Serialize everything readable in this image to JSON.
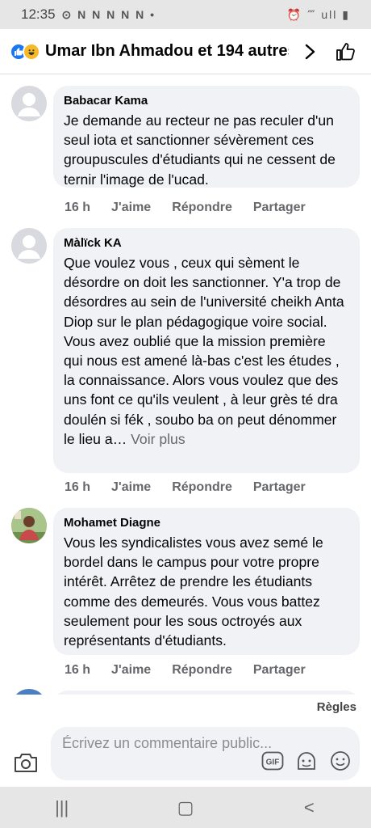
{
  "status": {
    "time": "12:35",
    "notifications": "⊙ N N N N N •",
    "right": "⏰ ⁗ ull ▮"
  },
  "header": {
    "title": "Umar Ibn Ahmadou et 194 autres ..."
  },
  "comments": [
    {
      "author": "Babacar Kama",
      "text": "Je demande au recteur ne pas reculer d'un seul iota et sanctionner sévèrement ces groupuscules d'étudiants qui ne cessent de ternir l'image de l'ucad.",
      "time": "16 h",
      "like": "J'aime",
      "reply": "Répondre",
      "share": "Partager"
    },
    {
      "author": "Màlïck KA",
      "text": "Que voulez vous , ceux qui sèment le désordre on doit les sanctionner. Y'a trop de désordres au sein de l'université cheikh Anta Diop sur le plan pédagogique voire social. Vous avez oublié que la mission première qui nous est amené là-bas c'est les études , la connaissance. Alors vous voulez que des uns font ce qu'ils veulent , à leur grès té dra doulén si fék , soubo ba on peut dénommer le lieu a…",
      "more": "Voir plus",
      "time": "16 h",
      "like": "J'aime",
      "reply": "Répondre",
      "share": "Partager"
    },
    {
      "author": "Mohamet Diagne",
      "text": "Vous les syndicalistes vous avez semé le bordel dans le campus pour votre propre intérêt. Arrêtez de prendre les étudiants comme des demeurés. Vous vous battez seulement pour les sous octroyés aux représentants d'étudiants.",
      "time": "16 h",
      "like": "J'aime",
      "reply": "Répondre",
      "share": "Partager"
    }
  ],
  "rules": "Règles",
  "composer": {
    "placeholder": "Écrivez un commentaire public...",
    "gif": "GIF"
  },
  "nav": {
    "recent": "|||",
    "home": "▢",
    "back": "<"
  }
}
